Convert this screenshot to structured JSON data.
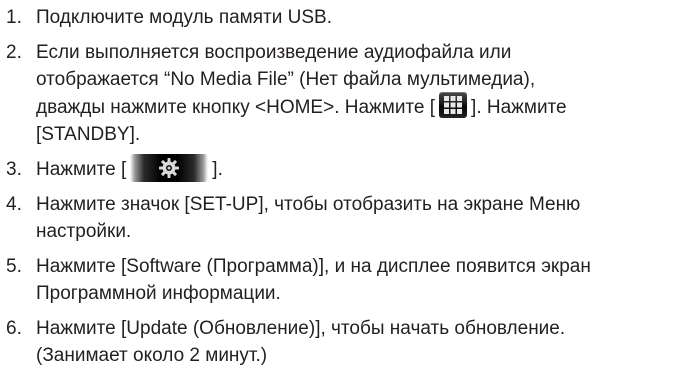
{
  "steps": [
    {
      "num": "1.",
      "text": "Подключите модуль памяти USB."
    },
    {
      "num": "2.",
      "line1": "Если выполняется воспроизведение аудиофайла или",
      "line2": "отображается “No Media File” (Нет файла мультимедиа),",
      "line3_before": "дважды нажмите кнопку <HOME>. Нажмите [",
      "line3_after": "]. Нажмите",
      "line4": "[STANDBY]."
    },
    {
      "num": "3.",
      "before": "Нажмите [",
      "after": "]."
    },
    {
      "num": "4.",
      "line1": "Нажмите значок [SET-UP], чтобы отобразить на экране Меню",
      "line2": "настройки."
    },
    {
      "num": "5.",
      "line1": "Нажмите [Software (Программа)], и на дисплее появится экран",
      "line2": "Программной информации."
    },
    {
      "num": "6.",
      "line1": "Нажмите [Update (Обновление)], чтобы начать обновление.",
      "line2": "(Занимает около 2 минут.)"
    }
  ],
  "icons": {
    "step2": "grid-menu-icon",
    "step3": "gear-settings-icon"
  }
}
